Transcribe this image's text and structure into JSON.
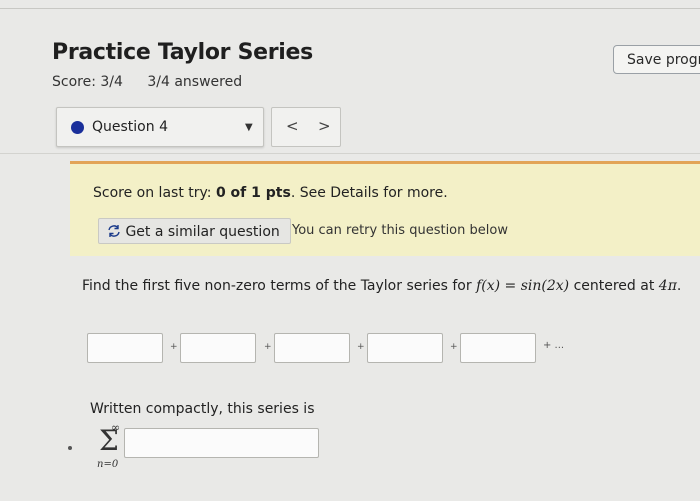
{
  "page": {
    "title": "Practice Taylor Series",
    "score": "Score: 3/4",
    "answered": "3/4 answered",
    "save_button": "Save progre"
  },
  "question_nav": {
    "selected": "Question 4",
    "prev": "<",
    "next": ">"
  },
  "alert": {
    "prefix": "Score on last try: ",
    "score_bold": "0 of 1 pts",
    "suffix": ". See Details for more.",
    "similar_button": "Get a similar question",
    "retry_text": "You can retry this question below"
  },
  "question": {
    "lead": "Find the first five non-zero terms of the Taylor series for ",
    "func": "f(x)",
    "eq": " = ",
    "rhs": "sin(2x)",
    "mid": " centered at ",
    "center": "4π",
    "end": "."
  },
  "terms": {
    "plus": "+",
    "ellipsis": "+ ..."
  },
  "compact": {
    "label": "Written compactly, this series is",
    "upper": "∞",
    "sigma": "Σ",
    "lower": "n=0"
  },
  "colors": {
    "accent_dot": "#1a2f9a",
    "alert_bg": "#f3f0c7",
    "alert_border": "#e2a457"
  }
}
